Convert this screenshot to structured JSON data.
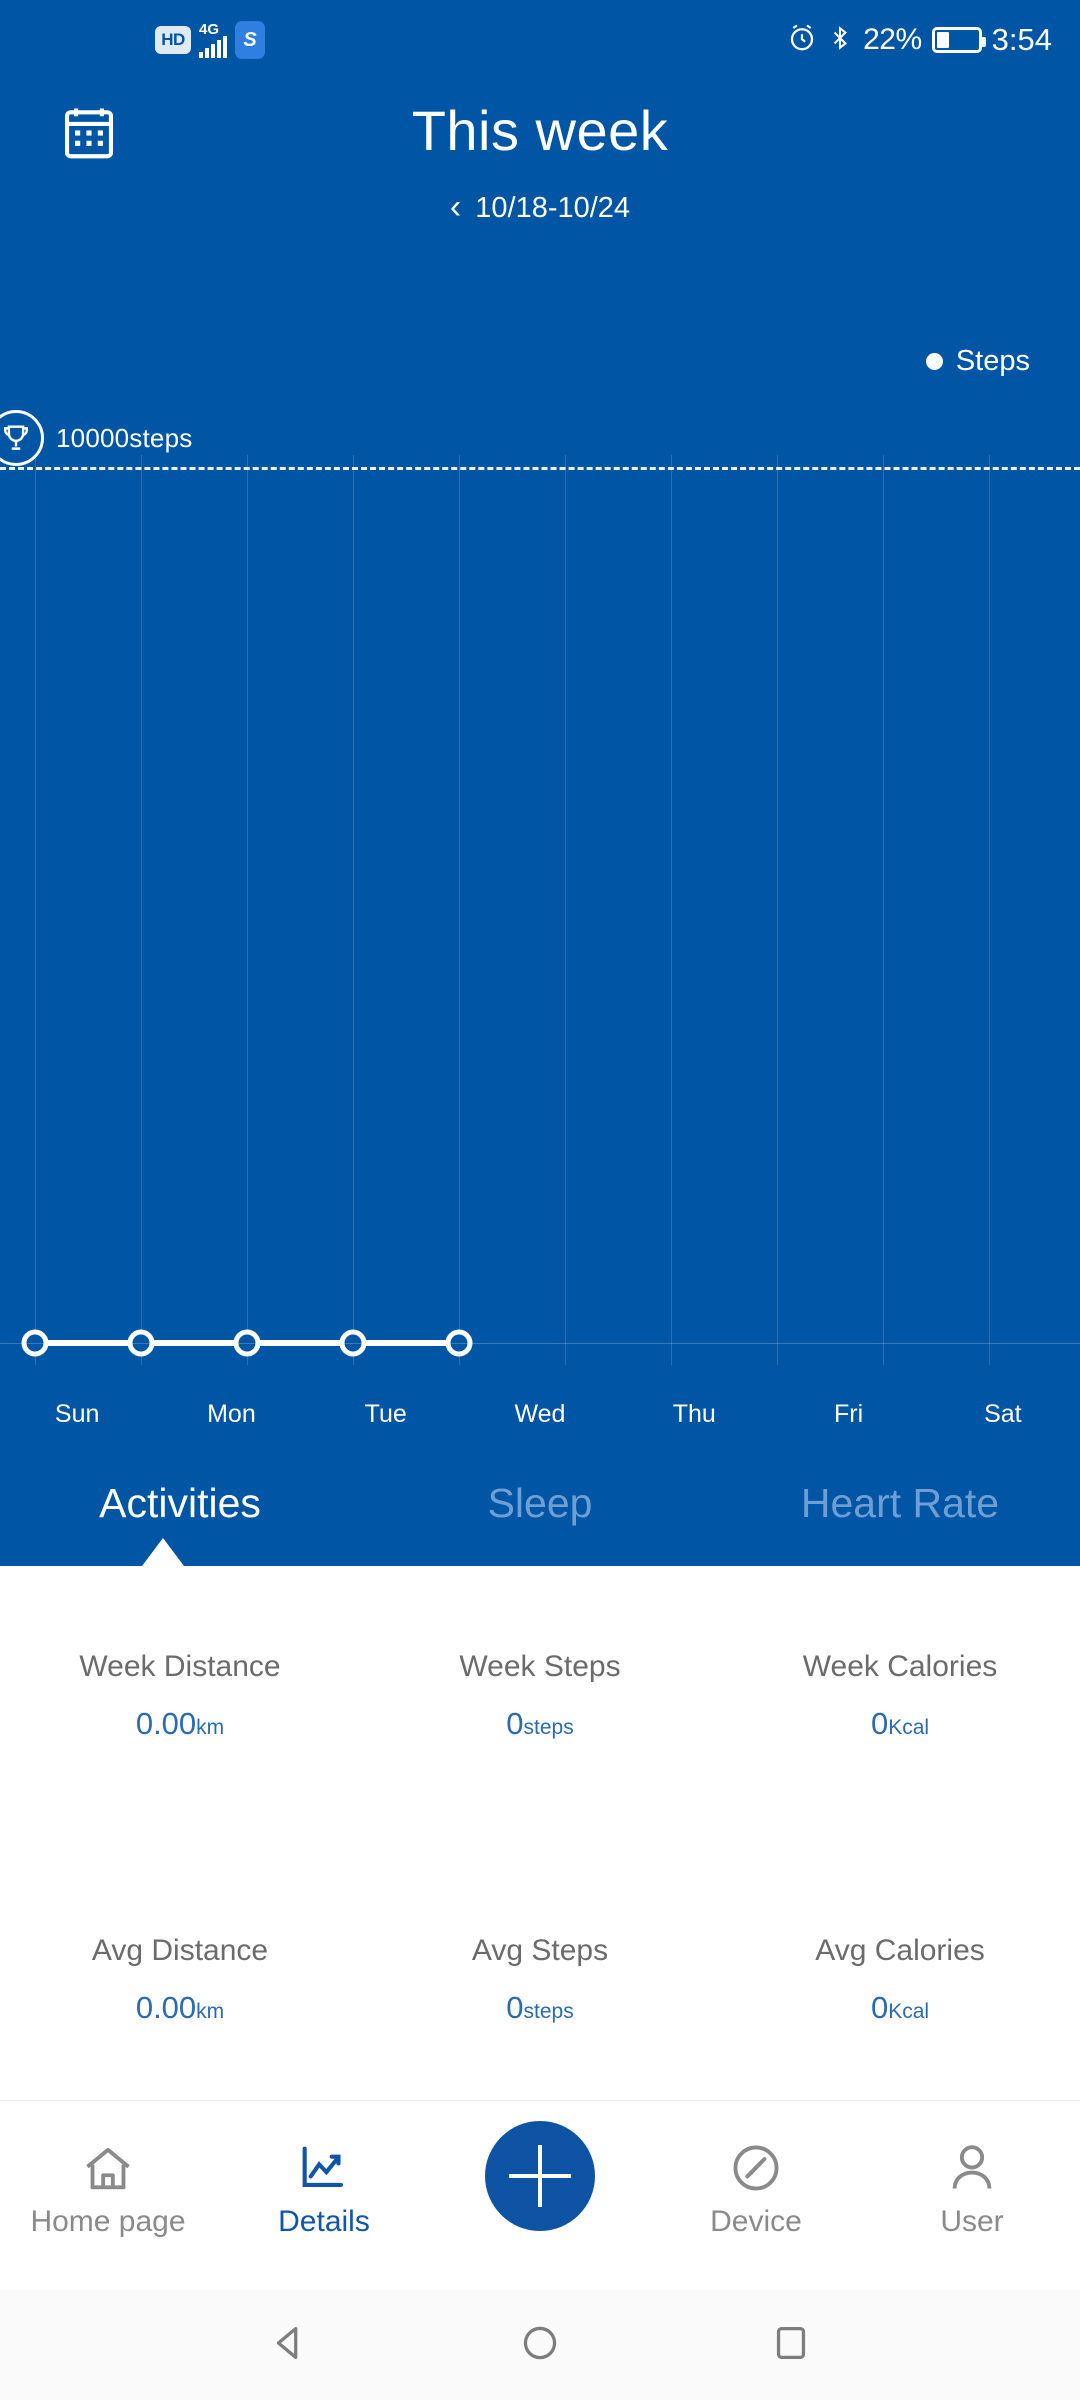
{
  "status_bar": {
    "hd_label": "HD",
    "network_type": "4G",
    "sim_label": "S",
    "alarm_icon": "alarm-icon",
    "bluetooth_icon": "bluetooth-icon",
    "battery_percent": "22%",
    "battery_level": 22,
    "clock": "3:54"
  },
  "header": {
    "calendar_icon": "calendar-icon",
    "title": "This week",
    "prev_chevron": "‹",
    "date_range": "10/18-10/24"
  },
  "legend": {
    "series_label": "Steps",
    "dot_color": "#ffffff"
  },
  "goal": {
    "trophy_icon": "trophy-icon",
    "label": "10000steps",
    "value": 10000
  },
  "chart_data": {
    "type": "line",
    "title": "This week",
    "series_name": "Steps",
    "categories": [
      "Sun",
      "Mon",
      "Tue",
      "Wed",
      "Thu",
      "Fri",
      "Sat"
    ],
    "values": [
      0,
      0,
      0,
      0,
      0,
      null,
      null
    ],
    "goal_line": 10000,
    "goal_line_label": "10000steps",
    "ylim": [
      0,
      11000
    ],
    "xlabel": "",
    "ylabel": "",
    "grid": true,
    "legend_position": "top-right",
    "marker": "hollow-circle",
    "line_color": "#ffffff"
  },
  "tabs": [
    {
      "label": "Activities",
      "active": true
    },
    {
      "label": "Sleep",
      "active": false
    },
    {
      "label": "Heart Rate",
      "active": false
    }
  ],
  "stats": {
    "row1": [
      {
        "label": "Week Distance",
        "value": "0.00",
        "unit": "km"
      },
      {
        "label": "Week Steps",
        "value": "0",
        "unit": "steps"
      },
      {
        "label": "Week Calories",
        "value": "0",
        "unit": "Kcal"
      }
    ],
    "row2": [
      {
        "label": "Avg Distance",
        "value": "0.00",
        "unit": "km"
      },
      {
        "label": "Avg Steps",
        "value": "0",
        "unit": "steps"
      },
      {
        "label": "Avg Calories",
        "value": "0",
        "unit": "Kcal"
      }
    ]
  },
  "bottom_nav": [
    {
      "label": "Home page",
      "icon": "home-icon",
      "active": false
    },
    {
      "label": "Details",
      "icon": "chart-line-icon",
      "active": true
    },
    {
      "label": "Device",
      "icon": "compass-icon",
      "active": false
    },
    {
      "label": "User",
      "icon": "person-icon",
      "active": false
    }
  ],
  "fab": {
    "icon": "plus-icon",
    "color": "#0F54A4"
  },
  "android_nav": {
    "back_icon": "back-triangle-icon",
    "home_icon": "home-circle-icon",
    "recents_icon": "recents-square-icon"
  },
  "colors": {
    "primary_blue": "#0055A5",
    "accent_blue": "#2a6bb0",
    "fab_blue": "#0F54A4",
    "inactive_tab": "#6d9fd4",
    "stat_label_gray": "#6b6b6b"
  }
}
